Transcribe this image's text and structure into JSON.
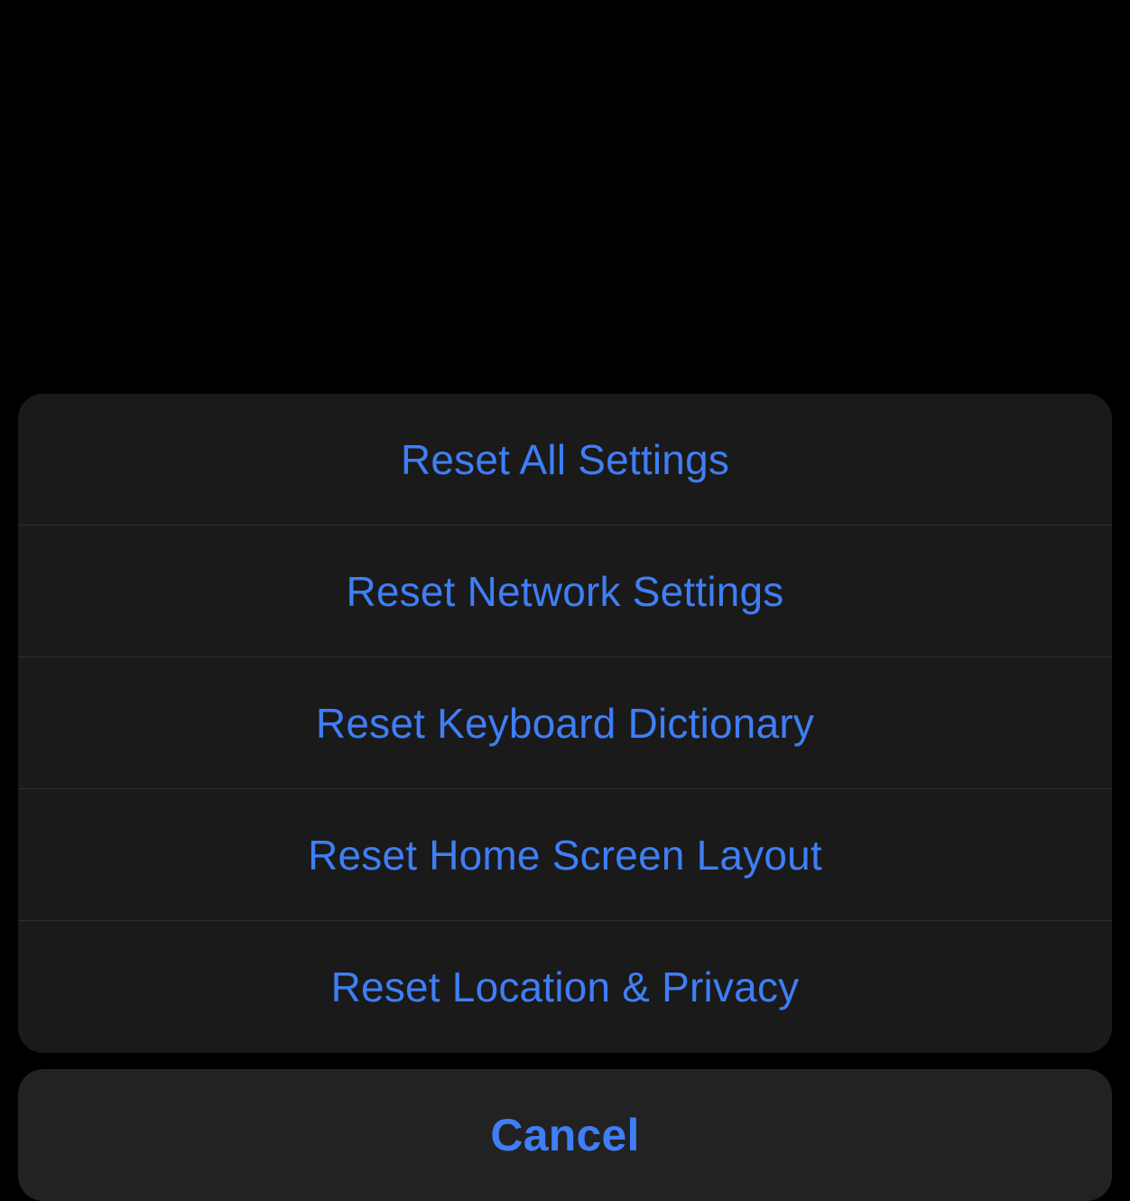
{
  "actionSheet": {
    "options": [
      {
        "label": "Reset All Settings"
      },
      {
        "label": "Reset Network Settings"
      },
      {
        "label": "Reset Keyboard Dictionary"
      },
      {
        "label": "Reset Home Screen Layout"
      },
      {
        "label": "Reset Location & Privacy"
      }
    ],
    "cancelLabel": "Cancel"
  },
  "colors": {
    "background": "#000000",
    "sheetBackground": "#1a1a1a",
    "cancelBackground": "#222222",
    "linkBlue": "#3f7ef5",
    "separator": "#2e2e2e"
  }
}
